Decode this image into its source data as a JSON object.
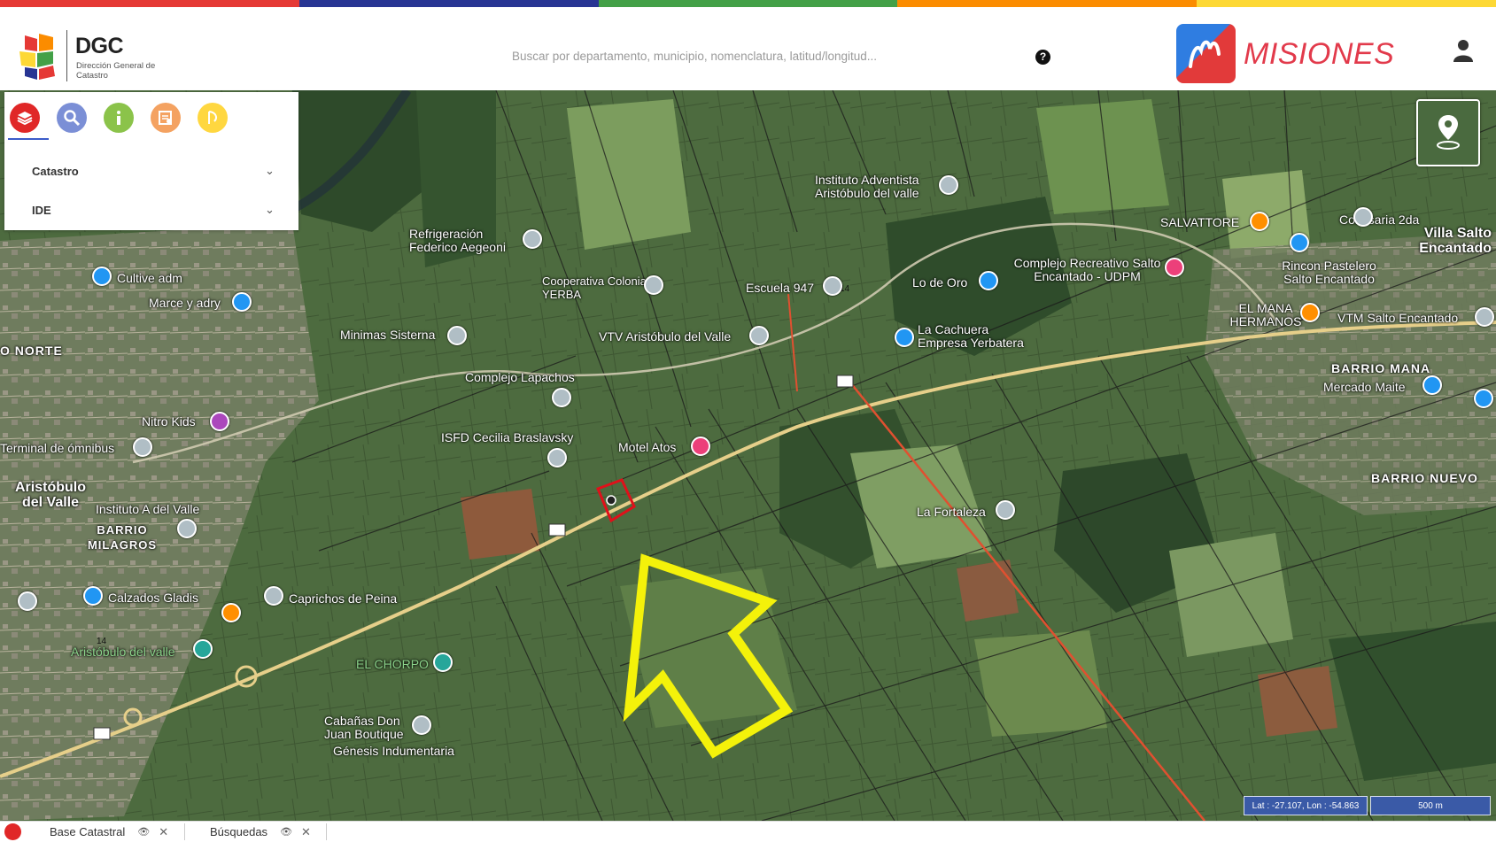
{
  "colors": {
    "stripe": [
      "#e53935",
      "#283593",
      "#43a047",
      "#fb8c00",
      "#fdd835"
    ],
    "accent": "#3b5bc9",
    "brand_red": "#e23a4b"
  },
  "header": {
    "logo_title": "DGC",
    "logo_subtitle": "Dirección General de Catastro",
    "search_placeholder": "Buscar por departamento, municipio, nomenclatura, latitud/longitud...",
    "help_glyph": "?",
    "brand_text": "MISIONES",
    "user_icon": "user-icon"
  },
  "panel": {
    "tools": [
      {
        "name": "layers-icon",
        "color": "#e02727",
        "glyph": "≋"
      },
      {
        "name": "search-icon",
        "color": "#7b8fd6",
        "glyph": "⌕"
      },
      {
        "name": "info-icon",
        "color": "#8bc34a",
        "glyph": "i"
      },
      {
        "name": "document-icon",
        "color": "#f4a261",
        "glyph": "▤"
      },
      {
        "name": "measure-icon",
        "color": "#ffd740",
        "glyph": "◔"
      }
    ],
    "sections": [
      {
        "label": "Catastro",
        "chevron": "⌄"
      },
      {
        "label": "IDE",
        "chevron": "⌄"
      }
    ]
  },
  "map": {
    "labels": {
      "villa_salto": "Villa Salto Encantado",
      "aristobulo": "Aristóbulo del Valle",
      "barrio_milagros": "BARRIO MILAGROS",
      "barrio_mana": "BARRIO MANA",
      "barrio_nuevo": "BARRIO NUEVO",
      "norte": "O NORTE",
      "instituto_adventista": "Instituto Adventista Aristóbulo del valle",
      "refrigeracion": "Refrigeración Federico Aegeoni",
      "cultive": "Cultive adm",
      "marce": "Marce y adry",
      "cooperativa": "Cooperativa Colonia YERBA",
      "escuela": "Escuela 947",
      "lo_de_oro": "Lo de Oro",
      "complejo_recreativo": "Complejo Recreativo Salto Encantado - UDPM",
      "comisaria": "Comisaria 2da",
      "salvattore": "SALVATTORE",
      "rincon": "Rincon Pastelero Salto Encantado",
      "el_mana": "EL MANA HERMANOS",
      "vtm": "VTM Salto Encantado",
      "mercado": "Mercado Maite",
      "minimas": "Minimas Sisterna",
      "vtv": "VTV Aristóbulo del Valle",
      "la_cachuera": "La Cachuera Empresa Yerbatera",
      "complejo_lapacho": "Complejo Lapachos",
      "nitro": "Nitro Kids",
      "terminal": "Terminal de ómnibus",
      "isfd": "ISFD Cecilia Braslavsky",
      "motel": "Motel Atos",
      "la_fortaleza": "La Fortaleza",
      "instituto_a": "Instituto A del Valle",
      "calzados": "Calzados Gladis",
      "caprichos": "Caprichos de Peina",
      "aristobulo_small": "Aristóbulo del valle",
      "el_chorpo": "EL CHORPO",
      "cabanas": "Cabañas Don Juan Boutique",
      "genesis": "Génesis Indumentaria",
      "route_14": "14"
    }
  },
  "status": {
    "coords": "Lat : -27.107, Lon : -54.863",
    "scale": "500 m"
  },
  "footer": {
    "tabs": [
      {
        "label": "Base Catastral"
      },
      {
        "label": "Búsquedas"
      }
    ],
    "eye_glyph": "👁",
    "close_glyph": "✕"
  }
}
